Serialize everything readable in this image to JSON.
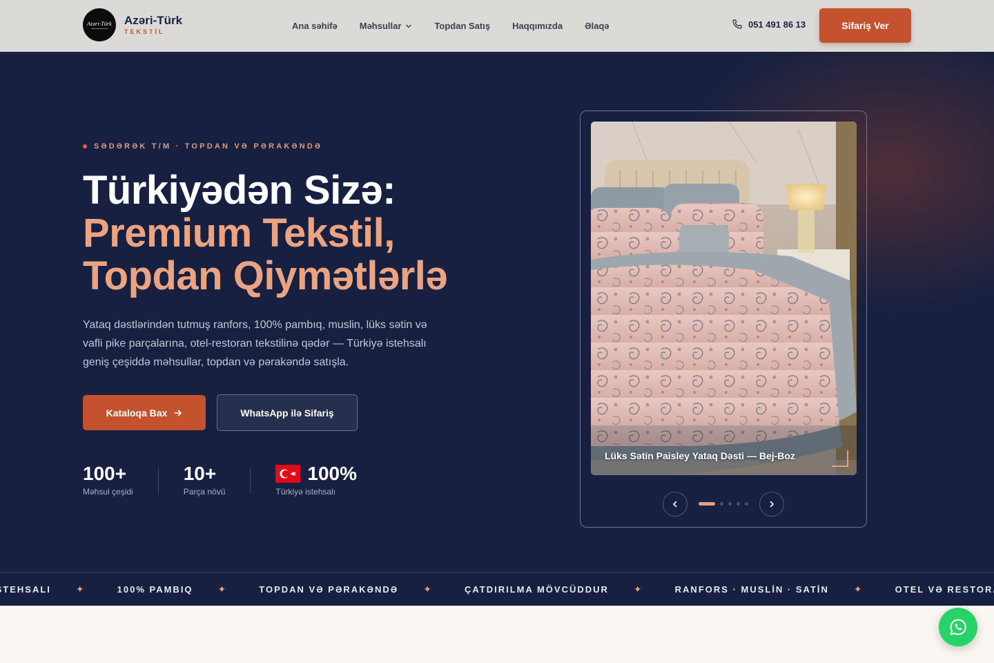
{
  "header": {
    "logo_badge_text": "Azəri-Türk",
    "logo_name": "Azəri-Türk",
    "logo_sub": "TEKSTİL",
    "nav": [
      {
        "label": "Ana səhifə"
      },
      {
        "label": "Məhsullar"
      },
      {
        "label": "Topdan Satış"
      },
      {
        "label": "Haqqımızda"
      },
      {
        "label": "Əlaqə"
      }
    ],
    "phone": "051 491 86 13",
    "order_button": "Sifariş Ver"
  },
  "hero": {
    "eyebrow": "SƏDƏRƏK T/M · TOPDAN VƏ PƏRAKƏNDƏ",
    "headline_line1": "Türkiyədən Sizə:",
    "headline_line2": "Premium Tekstil,",
    "headline_line3": "Topdan Qiymətlərlə",
    "lead": "Yataq dəstlərindən tutmuş ranfors, 100% pambıq, muslin, lüks sətin və vafli pike parçalarına, otel-restoran tekstilinə qədər — Türkiyə istehsalı geniş çeşiddə məhsullar, topdan və pərakəndə satışla.",
    "primary_button": "Kataloqa Bax",
    "secondary_button": "WhatsApp ilə Sifariş",
    "stats": [
      {
        "value": "100+",
        "label": "Məhsul çeşidi"
      },
      {
        "value": "10+",
        "label": "Parça növü"
      },
      {
        "value": "100%",
        "label": "Türkiyə istehsalı"
      }
    ]
  },
  "slider": {
    "caption": "Lüks Sətin Paisley Yataq Dəsti — Bej-Boz",
    "active_index": 0,
    "slide_count": 5
  },
  "marquee": {
    "items": [
      "İSTEHSALI",
      "100% PAMBIQ",
      "TOPDAN VƏ PƏRAKƏNDƏ",
      "ÇATDIRILMA MÖVCÜDDUR",
      "RANFORS · MUSLİN · SATİN",
      "OTEL VƏ RESTORAN TEKSTİLİ"
    ]
  },
  "colors": {
    "accent": "#c5522e",
    "navy": "#172040",
    "peach": "#eaa481",
    "whatsapp": "#25d366"
  }
}
